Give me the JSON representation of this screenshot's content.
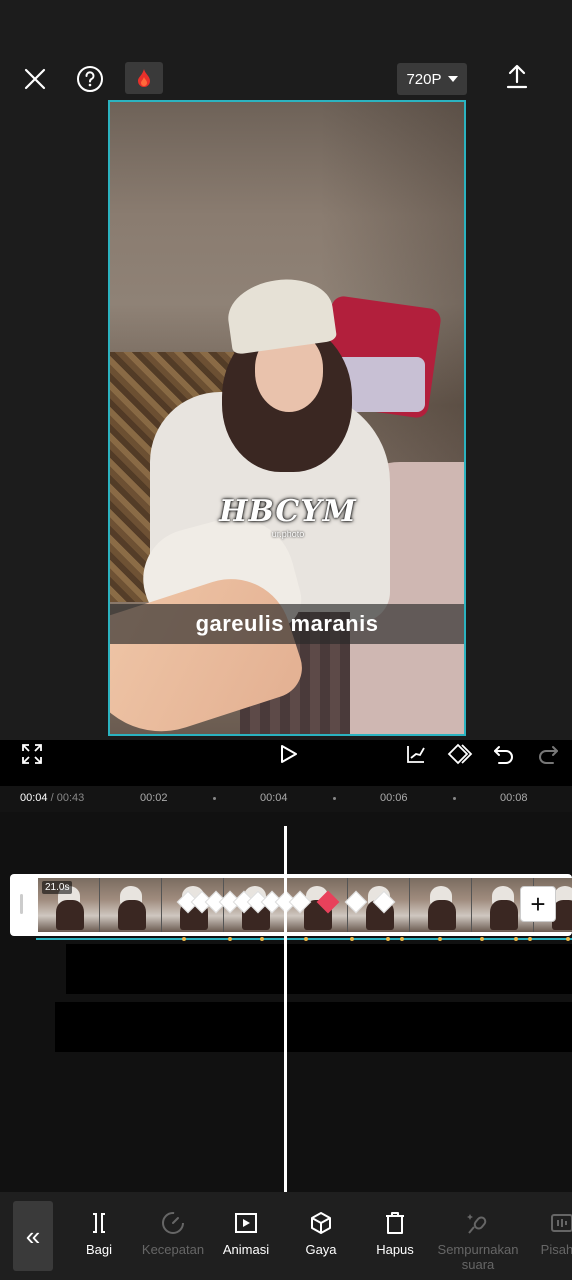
{
  "topbar": {
    "resolution": "720P",
    "close_icon": "close-icon",
    "help_icon": "help-icon",
    "fire_icon": "fire-icon",
    "export_icon": "export-icon"
  },
  "preview": {
    "watermark_main": "HBCYM",
    "watermark_sub": "ur.photo",
    "subtitle": "gareulis maranis"
  },
  "ruler": {
    "current": "00:04",
    "separator": " / ",
    "total": "00:43",
    "ticks": [
      "00:02",
      "00:04",
      "00:06",
      "00:08"
    ]
  },
  "track": {
    "duration_badge": "21.0s"
  },
  "bottom": {
    "collapse_label": "«",
    "tools": [
      {
        "label": "Bagi",
        "icon": "split-icon",
        "enabled": true
      },
      {
        "label": "Kecepatan",
        "icon": "speed-icon",
        "enabled": false
      },
      {
        "label": "Animasi",
        "icon": "animation-icon",
        "enabled": true
      },
      {
        "label": "Gaya",
        "icon": "style-cube-icon",
        "enabled": true
      },
      {
        "label": "Hapus",
        "icon": "delete-icon",
        "enabled": true
      },
      {
        "label": "Sempurnakan suara",
        "icon": "enhance-voice-icon",
        "enabled": false
      },
      {
        "label": "Pisah s",
        "icon": "separate-audio-icon",
        "enabled": false
      }
    ]
  },
  "colors": {
    "accent": "#2bb3c0",
    "keyframe_active": "#e8415b",
    "background": "#1c1c1c"
  }
}
